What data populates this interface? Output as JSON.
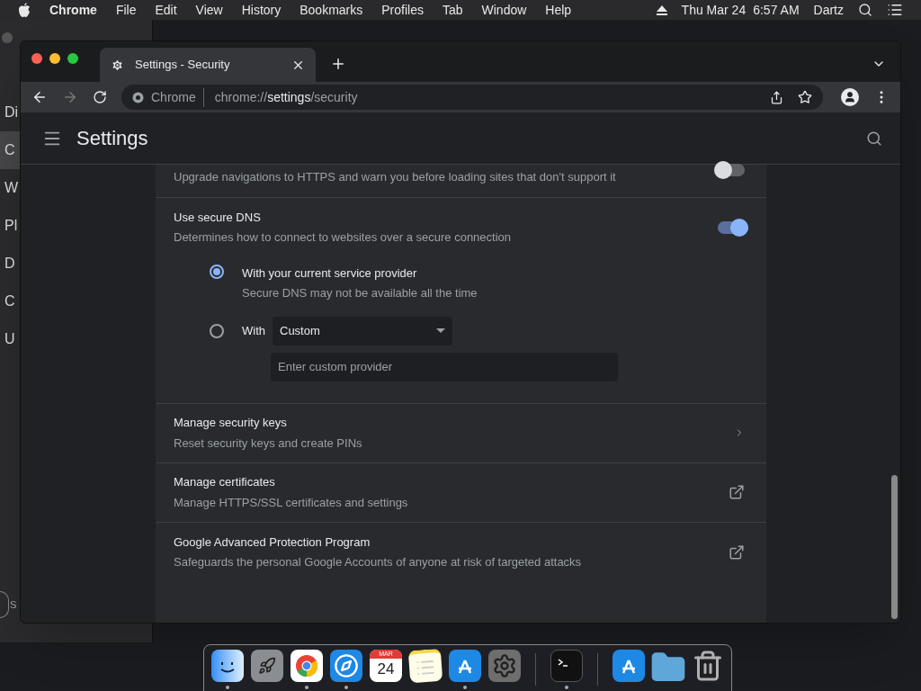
{
  "menu_bar": {
    "app": "Chrome",
    "items": [
      "File",
      "Edit",
      "View",
      "History",
      "Bookmarks",
      "Profiles",
      "Tab",
      "Window",
      "Help"
    ],
    "date": "Thu Mar 24",
    "time": "6:57 AM",
    "user": "Dartz"
  },
  "background_window": {
    "items": [
      {
        "label": "Di",
        "selected": false
      },
      {
        "label": "C",
        "selected": true
      },
      {
        "label": "W",
        "selected": false
      },
      {
        "label": "Pl",
        "selected": false
      },
      {
        "label": "D",
        "selected": false
      },
      {
        "label": "C",
        "selected": false
      },
      {
        "label": "U",
        "selected": false
      }
    ],
    "footer": "S"
  },
  "browser": {
    "tab": {
      "title": "Settings - Security"
    },
    "omnibox": {
      "site": "Chrome",
      "url_prefix": "chrome://",
      "url_host": "settings",
      "url_path": "/security"
    }
  },
  "settings": {
    "title": "Settings",
    "rows": [
      {
        "kind": "toggle",
        "description": "Upgrade navigations to HTTPS and warn you before loading sites that don't support it",
        "on": false
      },
      {
        "kind": "dns",
        "title": "Use secure DNS",
        "description": "Determines how to connect to websites over a secure connection",
        "on": true,
        "options": [
          {
            "label": "With your current service provider",
            "hint": "Secure DNS may not be available all the time",
            "selected": true
          },
          {
            "label": "With",
            "selected": false
          }
        ],
        "dropdown": "Custom",
        "custom_placeholder": "Enter custom provider"
      },
      {
        "kind": "arrow",
        "title": "Manage security keys",
        "description": "Reset security keys and create PINs"
      },
      {
        "kind": "external",
        "title": "Manage certificates",
        "description": "Manage HTTPS/SSL certificates and settings"
      },
      {
        "kind": "external",
        "title": "Google Advanced Protection Program",
        "description": "Safeguards the personal Google Accounts of anyone at risk of targeted attacks"
      }
    ]
  },
  "dock": {
    "calendar_month": "MAR",
    "calendar_day": "24",
    "apps": [
      {
        "kind": "finder",
        "running": true
      },
      {
        "kind": "rocket",
        "running": false
      },
      {
        "kind": "chrome",
        "running": true
      },
      {
        "kind": "compass",
        "running": true
      },
      {
        "kind": "calendar",
        "running": false
      },
      {
        "kind": "notes",
        "running": false
      },
      {
        "kind": "appstore",
        "running": true
      },
      {
        "kind": "gear",
        "running": false
      },
      {
        "kind": "divider"
      },
      {
        "kind": "terminal",
        "running": true
      },
      {
        "kind": "divider"
      },
      {
        "kind": "appstore",
        "running": false
      },
      {
        "kind": "folder",
        "running": false
      },
      {
        "kind": "trash",
        "running": false
      }
    ]
  }
}
